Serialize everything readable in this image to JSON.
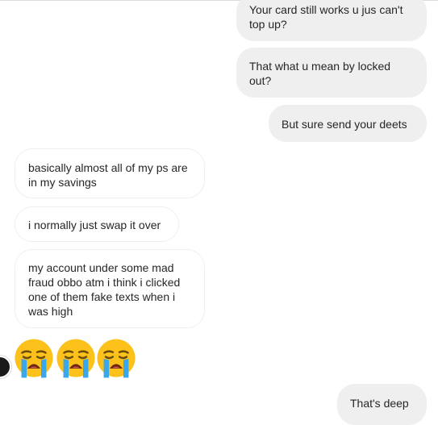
{
  "conversation": {
    "messages": [
      {
        "text": "Your card still works u jus can't top up?"
      },
      {
        "text": "That what u mean by locked out?"
      },
      {
        "text": "But sure send your deets"
      },
      {
        "text": "basically almost all of my ps are in my savings"
      },
      {
        "text": "i normally just swap it over"
      },
      {
        "text": "my account under some mad fraud obbo atm i think i clicked one of them fake texts when i was high"
      },
      {
        "text": "That's deep"
      }
    ],
    "emoji_message": {
      "emoji": [
        "loudly-crying-face",
        "loudly-crying-face",
        "loudly-crying-face"
      ]
    }
  },
  "colors": {
    "outgoing_bubble": "#efefef",
    "incoming_border": "#efefef",
    "text": "#262626",
    "emoji_face": "#fcc21b",
    "emoji_tears": "#3aa7ea"
  }
}
